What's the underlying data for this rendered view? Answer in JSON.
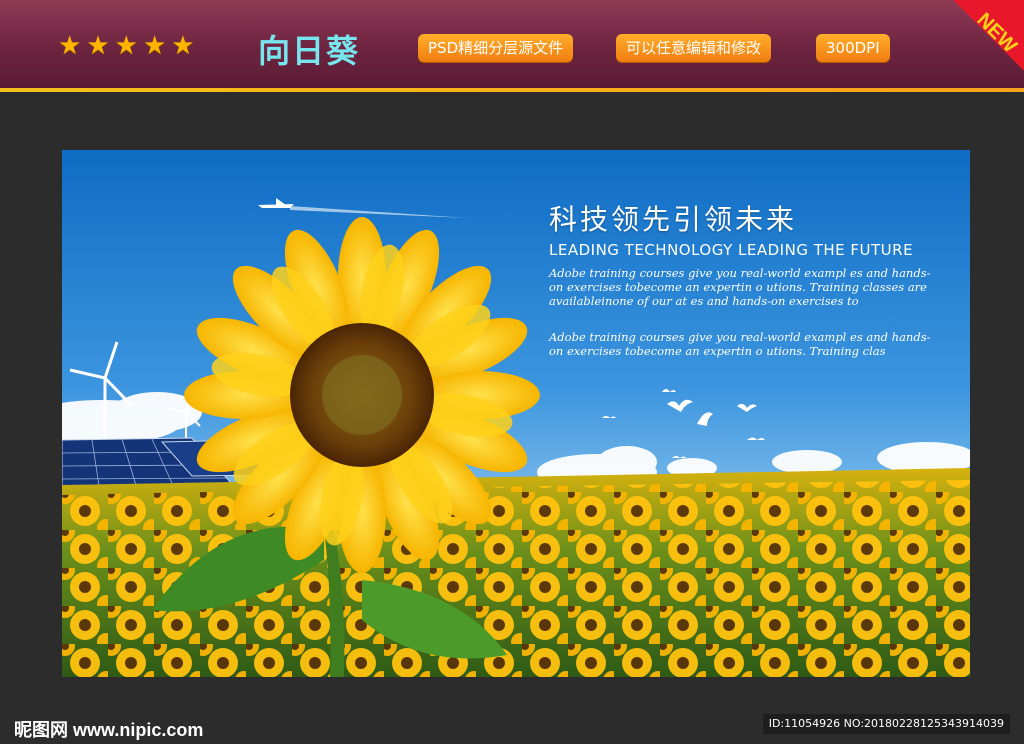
{
  "header": {
    "stars": [
      "★",
      "★",
      "★",
      "★",
      "★"
    ],
    "title": "向日葵",
    "tags": [
      "PSD精细分层源文件",
      "可以任意编辑和修改",
      "300DPI"
    ],
    "new_label": "NEW"
  },
  "poster": {
    "heading": "科技领先引领未来",
    "subheading": "LEADING TECHNOLOGY LEADING THE FUTURE",
    "paragraph1": "Adobe training courses give you real-world exampl es and hands-on exercises tobecome an expertin o utions. Training classes are availableinone of our at es and hands-on exercises to",
    "paragraph2": "Adobe training courses give you real-world exampl es and hands-on exercises tobecome an expertin o utions. Training clas"
  },
  "footer": {
    "logo_cn": "昵图网",
    "logo_url": "www.nipic.com",
    "id_text": "ID:11054926 NO:20180228125343914039"
  },
  "colors": {
    "header_bg": "#6d2440",
    "accent_gold": "#f4c21a",
    "tag_orange": "#f7941d",
    "title_cyan": "#77e6ef",
    "new_red": "#e8182a",
    "sky_blue": "#1a7bd0",
    "sunflower_yellow": "#ffc20e"
  }
}
